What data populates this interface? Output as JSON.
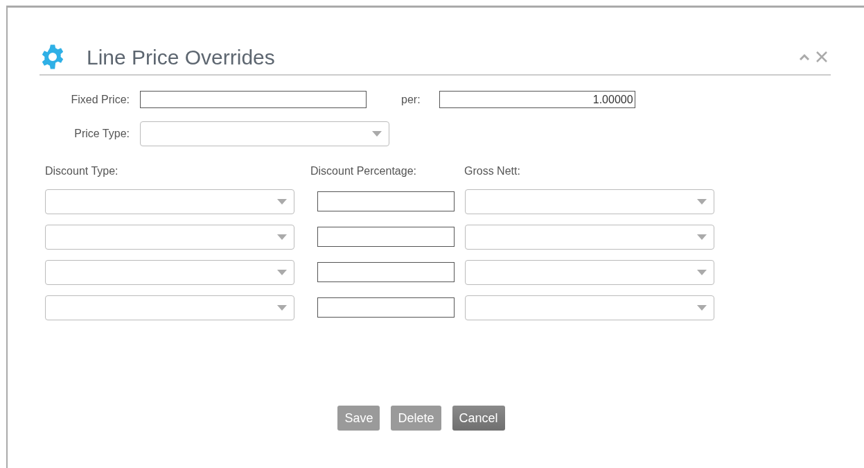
{
  "dialog": {
    "title": "Line Price Overrides"
  },
  "fixed_price": {
    "label": "Fixed Price:",
    "per_label": "per:",
    "per_value": "1.00000"
  },
  "price_type": {
    "label": "Price Type:"
  },
  "discounts": {
    "columns": [
      "Discount Type:",
      "Discount Percentage:",
      "Gross Nett:"
    ],
    "row_count_rows": [
      {},
      {},
      {},
      {}
    ]
  },
  "buttons": [
    {
      "label": "Save",
      "kind": "light"
    },
    {
      "label": "Delete",
      "kind": "light"
    },
    {
      "label": "Cancel",
      "kind": "dark"
    }
  ]
}
